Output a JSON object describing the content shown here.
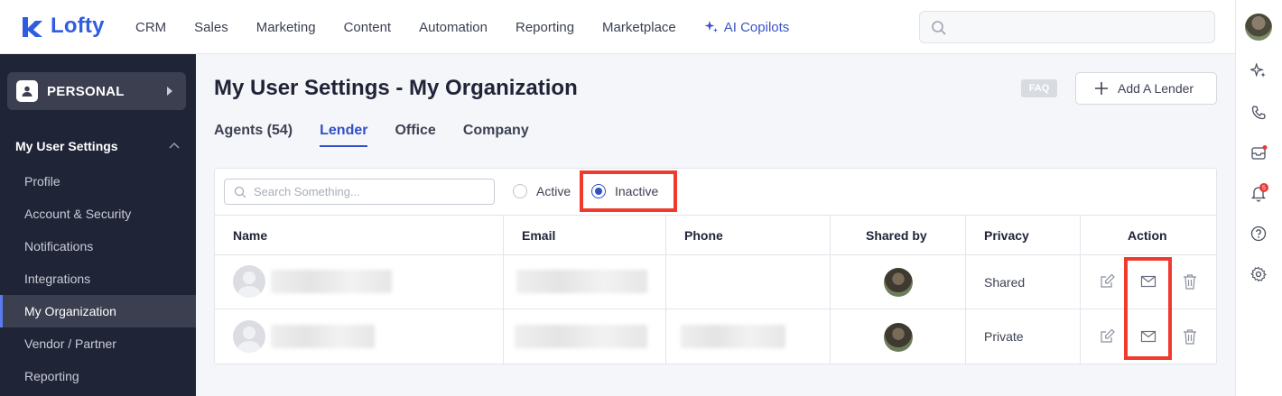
{
  "app": {
    "name": "Lofty"
  },
  "nav": [
    "CRM",
    "Sales",
    "Marketing",
    "Content",
    "Automation",
    "Reporting",
    "Marketplace",
    "AI Copilots"
  ],
  "notifications_badge": "5",
  "sidebar": {
    "workspace": "PERSONAL",
    "section": "My User Settings",
    "items": [
      "Profile",
      "Account & Security",
      "Notifications",
      "Integrations",
      "My Organization",
      "Vendor / Partner",
      "Reporting"
    ],
    "active_index": 4
  },
  "page": {
    "title": "My User Settings - My Organization",
    "faq": "FAQ",
    "add_button": "Add A Lender"
  },
  "tabs": [
    "Agents (54)",
    "Lender",
    "Office",
    "Company"
  ],
  "active_tab": 1,
  "filter": {
    "search_placeholder": "Search Something...",
    "options": [
      "Active",
      "Inactive"
    ],
    "selected": "Inactive"
  },
  "table": {
    "columns": [
      "Name",
      "Email",
      "Phone",
      "Shared by",
      "Privacy",
      "Action"
    ],
    "rows": [
      {
        "privacy": "Shared"
      },
      {
        "privacy": "Private"
      }
    ]
  },
  "colors": {
    "brand": "#2f5de0",
    "sidebar": "#202437",
    "highlight": "#ef3b2d",
    "active_tab": "#3150c4"
  }
}
